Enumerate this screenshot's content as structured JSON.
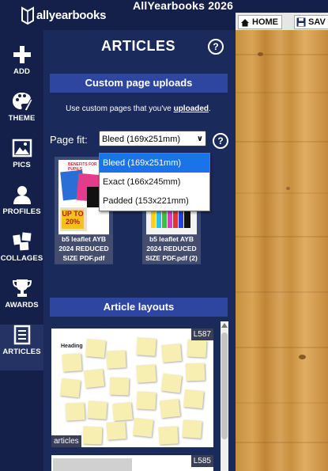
{
  "app": {
    "logo_text": "allyearbooks",
    "title": "AllYearbooks 2026"
  },
  "canvas_toolbar": {
    "home_label": "HOME",
    "save_label": "SAV"
  },
  "rail": {
    "items": [
      {
        "label": "ADD",
        "icon": "plus-icon"
      },
      {
        "label": "THEME",
        "icon": "palette-icon"
      },
      {
        "label": "PICS",
        "icon": "image-icon"
      },
      {
        "label": "PROFILES",
        "icon": "person-icon"
      },
      {
        "label": "COLLAGES",
        "icon": "collage-icon"
      },
      {
        "label": "AWARDS",
        "icon": "trophy-icon"
      },
      {
        "label": "ARTICLES",
        "icon": "document-icon"
      }
    ],
    "active": "ARTICLES"
  },
  "panel": {
    "title": "ARTICLES",
    "help": "?",
    "custom_uploads": {
      "header": "Custom page uploads",
      "note_prefix": "Use custom pages that you've ",
      "note_link": "uploaded",
      "note_suffix": ".",
      "page_fit_label": "Page fit:",
      "page_fit_value": "Bleed (169x251mm)",
      "page_fit_help": "?",
      "page_fit_options": [
        "Bleed (169x251mm)",
        "Exact (166x245mm)",
        "Padded (153x221mm)"
      ],
      "thumbnails": [
        {
          "caption": "b5 leaflet AYB 2024 REDUCED SIZE PDF.pdf",
          "text_top": "BENEFITS FOR PUPILS",
          "text_promo": "UP TO 20%"
        },
        {
          "caption": "b5 leaflet AYB 2024 REDUCED SIZE PDF.pdf (2)"
        }
      ]
    },
    "article_layouts": {
      "header": "Article layouts",
      "cards": [
        {
          "code": "L587",
          "tag": "articles",
          "heading": "Heading"
        },
        {
          "code": "L585"
        }
      ]
    }
  },
  "colors": {
    "navy": "#14204a",
    "panel": "#1a2a5a",
    "section_bar": "#2e46a0",
    "selected_option": "#1a73e8",
    "wood": "#d09a4c"
  }
}
